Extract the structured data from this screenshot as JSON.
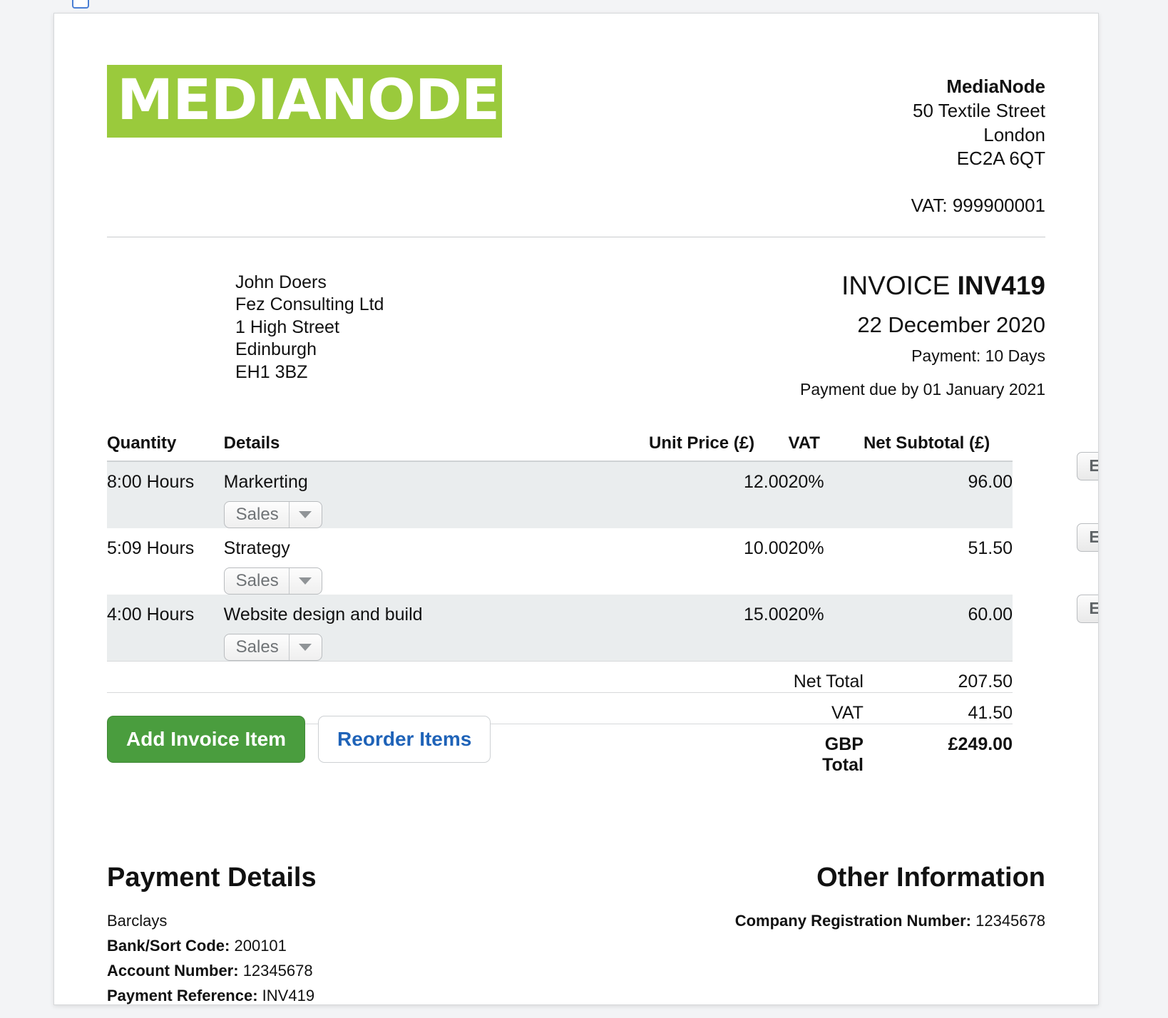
{
  "supplier": {
    "name": "MediaNode",
    "logo_text": "MEDIANODE",
    "logo_color": "#9ACA3C",
    "address_line_1": "50 Textile Street",
    "address_line_2": "London",
    "postcode": "EC2A 6QT",
    "vat": "VAT: 999900001"
  },
  "customer": {
    "contact": "John Doers",
    "company": "Fez Consulting Ltd",
    "address_line_1": "1 High Street",
    "city": "Edinburgh",
    "postcode": "EH1 3BZ"
  },
  "invoice": {
    "label": "INVOICE",
    "number": "INV419",
    "date": "22 December 2020",
    "payment_terms": "Payment: 10 Days",
    "payment_due": "Payment due by 01 January 2021"
  },
  "table": {
    "headers": {
      "quantity": "Quantity",
      "details": "Details",
      "unit_price": "Unit Price (£)",
      "vat": "VAT",
      "net_subtotal": "Net Subtotal (£)"
    },
    "rows": [
      {
        "quantity": "8:00 Hours",
        "details": "Markerting",
        "category": "Sales",
        "unit_price": "12.00",
        "vat": "20%",
        "net_subtotal": "96.00",
        "edit_label": "Edit",
        "delete_label": "✖"
      },
      {
        "quantity": "5:09 Hours",
        "details": "Strategy",
        "category": "Sales",
        "unit_price": "10.00",
        "vat": "20%",
        "net_subtotal": "51.50",
        "edit_label": "Edit",
        "delete_label": "✖"
      },
      {
        "quantity": "4:00 Hours",
        "details": "Website design and build",
        "category": "Sales",
        "unit_price": "15.00",
        "vat": "20%",
        "net_subtotal": "60.00",
        "edit_label": "Edit",
        "delete_label": "✖"
      }
    ],
    "totals": {
      "net_total_label": "Net Total",
      "net_total_value": "207.50",
      "vat_label": "VAT",
      "vat_value": "41.50",
      "grand_total_label": "GBP Total",
      "grand_total_value": "£249.00"
    }
  },
  "actions": {
    "add_invoice_item": "Add Invoice Item",
    "reorder_items": "Reorder Items",
    "add_button_color": "#4a9d3e",
    "reorder_text_color": "#1f63b8"
  },
  "footer": {
    "payment_details_title": "Payment Details",
    "bank_name": "Barclays",
    "sort_code_label": "Bank/Sort Code:",
    "sort_code_value": "200101",
    "account_number_label": "Account Number:",
    "account_number_value": "12345678",
    "payment_reference_label": "Payment Reference:",
    "payment_reference_value": "INV419",
    "other_information_title": "Other Information",
    "company_reg_label": "Company Registration Number:",
    "company_reg_value": "12345678"
  }
}
